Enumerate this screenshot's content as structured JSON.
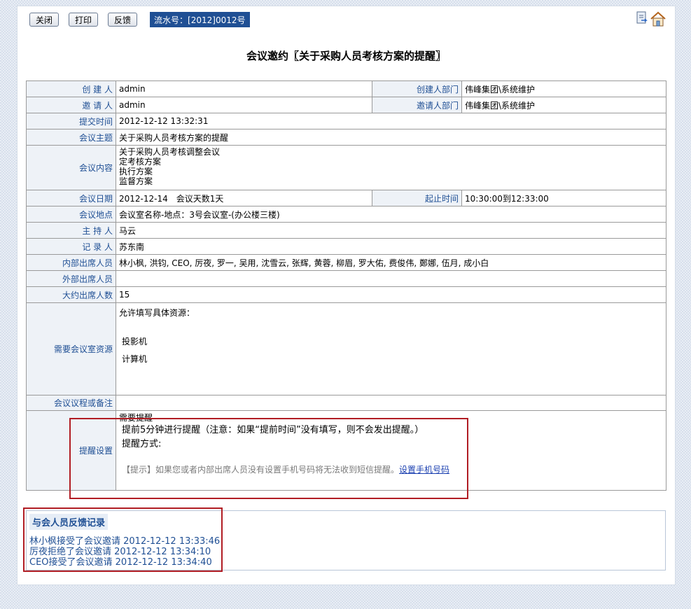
{
  "toolbar": {
    "close_label": "关闭",
    "print_label": "打印",
    "feedback_label": "反馈",
    "serial": "流水号：[2012]0012号"
  },
  "title": "会议邀约〖关于采购人员考核方案的提醒〗",
  "info": {
    "creator_label": "创 建 人",
    "creator": "admin",
    "creator_dept_label": "创建人部门",
    "creator_dept": "伟峰集团\\系统维护",
    "inviter_label": "邀 请 人",
    "inviter": "admin",
    "inviter_dept_label": "邀请人部门",
    "inviter_dept": "伟峰集团\\系统维护",
    "submit_time_label": "提交时间",
    "submit_time": "2012-12-12 13:32:31",
    "subject_label": "会议主题",
    "subject": "关于采购人员考核方案的提醒",
    "content_label": "会议内容",
    "content_lines": [
      "关于采购人员考核调整会议",
      "定考核方案",
      "执行方案",
      "监督方案"
    ],
    "date_label": "会议日期",
    "date": "2012-12-14　会议天数1天",
    "time_range_label": "起止时间",
    "time_range": "10:30:00到12:33:00",
    "location_label": "会议地点",
    "location": "会议室名称-地点：3号会议室-(办公楼三楼)",
    "host_label": "主 持 人",
    "host": "马云",
    "recorder_label": "记 录 人",
    "recorder": "苏东南",
    "internal_label": "内部出席人员",
    "internal": "林小枫, 洪钧, CEO, 厉夜, 罗一, 吴用, 沈雪云, 张辉, 黄蓉, 柳眉, 罗大佑, 费俊伟, 鄭娜, 伍月, 成小白",
    "external_label": "外部出席人员",
    "external": "",
    "headcount_label": "大约出席人数",
    "headcount": "15",
    "resources_label": "需要会议室资源",
    "resources_intro": "允许填写具体资源：",
    "resource_items": [
      "投影机",
      "计算机"
    ],
    "agenda_label": "会议议程或备注",
    "agenda": "",
    "reminder_label": "提醒设置",
    "reminder_title": "需要提醒",
    "reminder_line1": "提前5分钟进行提醒（注意：如果“提前时间”没有填写，则不会发出提醒。）",
    "reminder_line2": "提醒方式:",
    "reminder_tip": "【提示】如果您或者内部出席人员没有设置手机号码将无法收到短信提醒。",
    "reminder_link": "设置手机号码"
  },
  "feedback": {
    "title": "与会人员反馈记录",
    "records": [
      "林小枫接受了会议邀请 2012-12-12 13:33:46",
      "厉夜拒绝了会议邀请 2012-12-12 13:34:10",
      "CEO接受了会议邀请 2012-12-12 13:34:40"
    ]
  },
  "colors": {
    "label_text": "#1f4f94",
    "serial_bg": "#1f4f94",
    "highlight_box": "#b11d24"
  },
  "icons": [
    "document-return-icon",
    "home-icon"
  ]
}
